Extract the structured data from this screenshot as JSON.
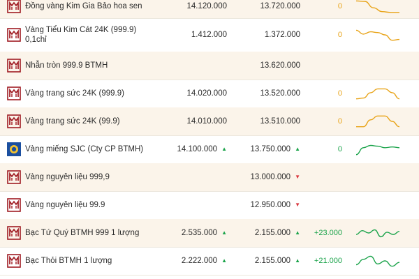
{
  "colors": {
    "accent_gold": "#e8a317",
    "up_green": "#1aa34a",
    "down_red": "#d9363e",
    "row_alt": "#fbf4ea",
    "brand_red": "#a01c23"
  },
  "rows": [
    {
      "name": "Đồng vàng Kim Gia Bảo hoa sen",
      "buy": "14.120.000",
      "buy_dir": "",
      "sell": "13.720.000",
      "sell_dir": "",
      "change": "0",
      "change_type": "zero",
      "logo": "btmh-logo",
      "spark": [
        0.15,
        0.18,
        0.6,
        0.85,
        0.9,
        0.9
      ]
    },
    {
      "name": "Vàng Tiểu Kim Cát 24K (999.9) 0,1chỉ",
      "buy": "1.412.000",
      "buy_dir": "",
      "sell": "1.372.000",
      "sell_dir": "",
      "change": "0",
      "change_type": "zero",
      "logo": "btmh-logo",
      "spark": [
        0.2,
        0.45,
        0.3,
        0.35,
        0.5,
        0.85,
        0.8
      ]
    },
    {
      "name": "Nhẫn tròn 999.9 BTMH",
      "buy": "",
      "buy_dir": "",
      "sell": "13.620.000",
      "sell_dir": "",
      "change": "",
      "change_type": "",
      "logo": "btmh-logo",
      "spark": []
    },
    {
      "name": "Vàng trang sức 24K (999.9)",
      "buy": "14.020.000",
      "buy_dir": "",
      "sell": "13.520.000",
      "sell_dir": "",
      "change": "0",
      "change_type": "zero",
      "logo": "btmh-logo",
      "spark": [
        0.85,
        0.8,
        0.45,
        0.2,
        0.2,
        0.45,
        0.85
      ]
    },
    {
      "name": "Vàng trang sức 24K (99.9)",
      "buy": "14.010.000",
      "buy_dir": "",
      "sell": "13.510.000",
      "sell_dir": "",
      "change": "0",
      "change_type": "zero",
      "logo": "btmh-logo",
      "spark": [
        0.85,
        0.85,
        0.4,
        0.15,
        0.15,
        0.5,
        0.85
      ]
    },
    {
      "name": "Vàng miếng SJC (Cty CP BTMH)",
      "buy": "14.100.000",
      "buy_dir": "up",
      "sell": "13.750.000",
      "sell_dir": "up",
      "change": "0",
      "change_type": "pos",
      "logo": "sjc-logo",
      "spark": [
        0.85,
        0.4,
        0.25,
        0.3,
        0.4,
        0.35,
        0.4
      ]
    },
    {
      "name": "Vàng nguyên liệu 999,9",
      "buy": "",
      "buy_dir": "",
      "sell": "13.000.000",
      "sell_dir": "down",
      "change": "",
      "change_type": "",
      "logo": "btmh-logo",
      "spark": []
    },
    {
      "name": "Vàng nguyên liệu 99.9",
      "buy": "",
      "buy_dir": "",
      "sell": "12.950.000",
      "sell_dir": "down",
      "change": "",
      "change_type": "",
      "logo": "btmh-logo",
      "spark": []
    },
    {
      "name": "Bạc Tứ Quý BTMH 999 1 lượng",
      "buy": "2.535.000",
      "buy_dir": "up",
      "sell": "2.155.000",
      "sell_dir": "up",
      "change": "+23.000",
      "change_type": "pos",
      "logo": "btmh-logo",
      "spark": [
        0.6,
        0.35,
        0.5,
        0.3,
        0.75,
        0.45,
        0.6,
        0.4
      ]
    },
    {
      "name": "Bạc Thỏi BTMH 1 lượng",
      "buy": "2.222.000",
      "buy_dir": "up",
      "sell": "2.155.000",
      "sell_dir": "up",
      "change": "+21.000",
      "change_type": "pos",
      "logo": "btmh-logo",
      "spark": [
        0.75,
        0.4,
        0.2,
        0.7,
        0.5,
        0.85,
        0.6
      ]
    }
  ]
}
